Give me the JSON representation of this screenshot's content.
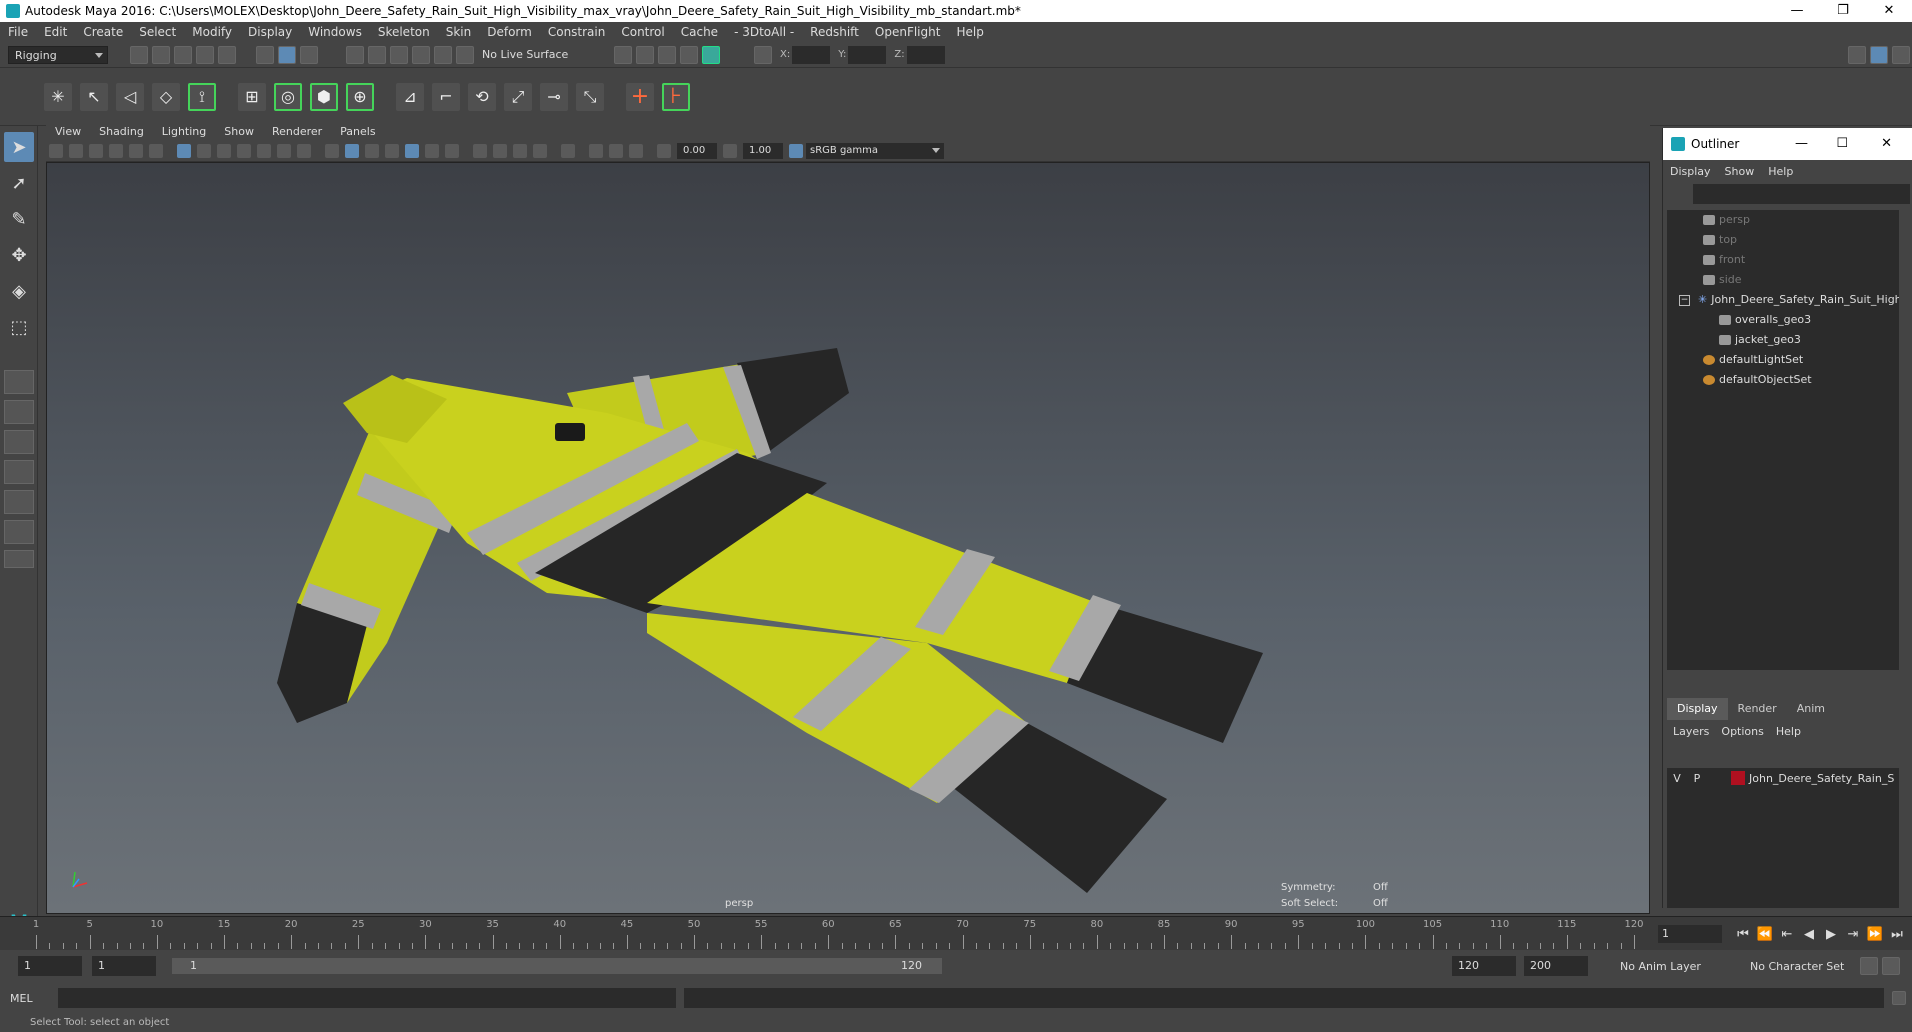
{
  "window": {
    "title": "Autodesk Maya 2016: C:\\Users\\MOLEX\\Desktop\\John_Deere_Safety_Rain_Suit_High_Visibility_max_vray\\John_Deere_Safety_Rain_Suit_High_Visibility_mb_standart.mb*",
    "minimize": "—",
    "restore": "❐",
    "close": "✕"
  },
  "menubar": [
    "File",
    "Edit",
    "Create",
    "Select",
    "Modify",
    "Display",
    "Windows",
    "Skeleton",
    "Skin",
    "Deform",
    "Constrain",
    "Control",
    "Cache",
    "- 3DtoAll -",
    "Redshift",
    "OpenFlight",
    "Help"
  ],
  "statusline": {
    "mode": "Rigging",
    "live_surface": "No Live Surface",
    "x_label": "X:",
    "y_label": "Y:",
    "z_label": "Z:"
  },
  "panel": {
    "menu": [
      "View",
      "Shading",
      "Lighting",
      "Show",
      "Renderer",
      "Panels"
    ],
    "exposure": "0.00",
    "gamma_value": "1.00",
    "color_space": "sRGB gamma"
  },
  "viewport": {
    "camera": "persp",
    "symmetry_label": "Symmetry:",
    "symmetry_value": "Off",
    "soft_select_label": "Soft Select:",
    "soft_select_value": "Off"
  },
  "outliner": {
    "title": "Outliner",
    "menu": [
      "Display",
      "Show",
      "Help"
    ],
    "items": [
      {
        "label": "persp",
        "icon": "camera-icon",
        "indent": 2,
        "dim": true
      },
      {
        "label": "top",
        "icon": "camera-icon",
        "indent": 2,
        "dim": true
      },
      {
        "label": "front",
        "icon": "camera-icon",
        "indent": 2,
        "dim": true
      },
      {
        "label": "side",
        "icon": "camera-icon",
        "indent": 2,
        "dim": true
      },
      {
        "label": "John_Deere_Safety_Rain_Suit_High_Visibility",
        "icon": "group-icon",
        "indent": 1,
        "dim": false,
        "expand": "−"
      },
      {
        "label": "overalls_geo3",
        "icon": "mesh-icon",
        "indent": 3,
        "dim": false
      },
      {
        "label": "jacket_geo3",
        "icon": "mesh-icon",
        "indent": 3,
        "dim": false
      },
      {
        "label": "defaultLightSet",
        "icon": "set-icon",
        "indent": 2,
        "dim": false
      },
      {
        "label": "defaultObjectSet",
        "icon": "set-icon",
        "indent": 2,
        "dim": false
      }
    ]
  },
  "layers": {
    "tabs": [
      "Display",
      "Render",
      "Anim"
    ],
    "menu": [
      "Layers",
      "Options",
      "Help"
    ],
    "rows": [
      {
        "v": "V",
        "p": "P",
        "name": "John_Deere_Safety_Rain_S",
        "color": "#b01020"
      }
    ]
  },
  "timeline": {
    "ticks": [
      1,
      5,
      10,
      15,
      20,
      25,
      30,
      35,
      40,
      45,
      50,
      55,
      60,
      65,
      70,
      75,
      80,
      85,
      90,
      95,
      100,
      105,
      110,
      115,
      120
    ],
    "current_frame": "1"
  },
  "range": {
    "start": "1",
    "playback_start": "1",
    "track_start": "1",
    "track_end": "120",
    "playback_end": "120",
    "end": "200",
    "anim_layer": "No Anim Layer",
    "character_set": "No Character Set"
  },
  "cmdline": {
    "label": "MEL",
    "help": "Select Tool: select an object"
  },
  "colors": {
    "suit_yellow": "#c7cf1a",
    "suit_black": "#262626",
    "reflective": "#a8a8a8",
    "accent": "#5d8ab5"
  }
}
